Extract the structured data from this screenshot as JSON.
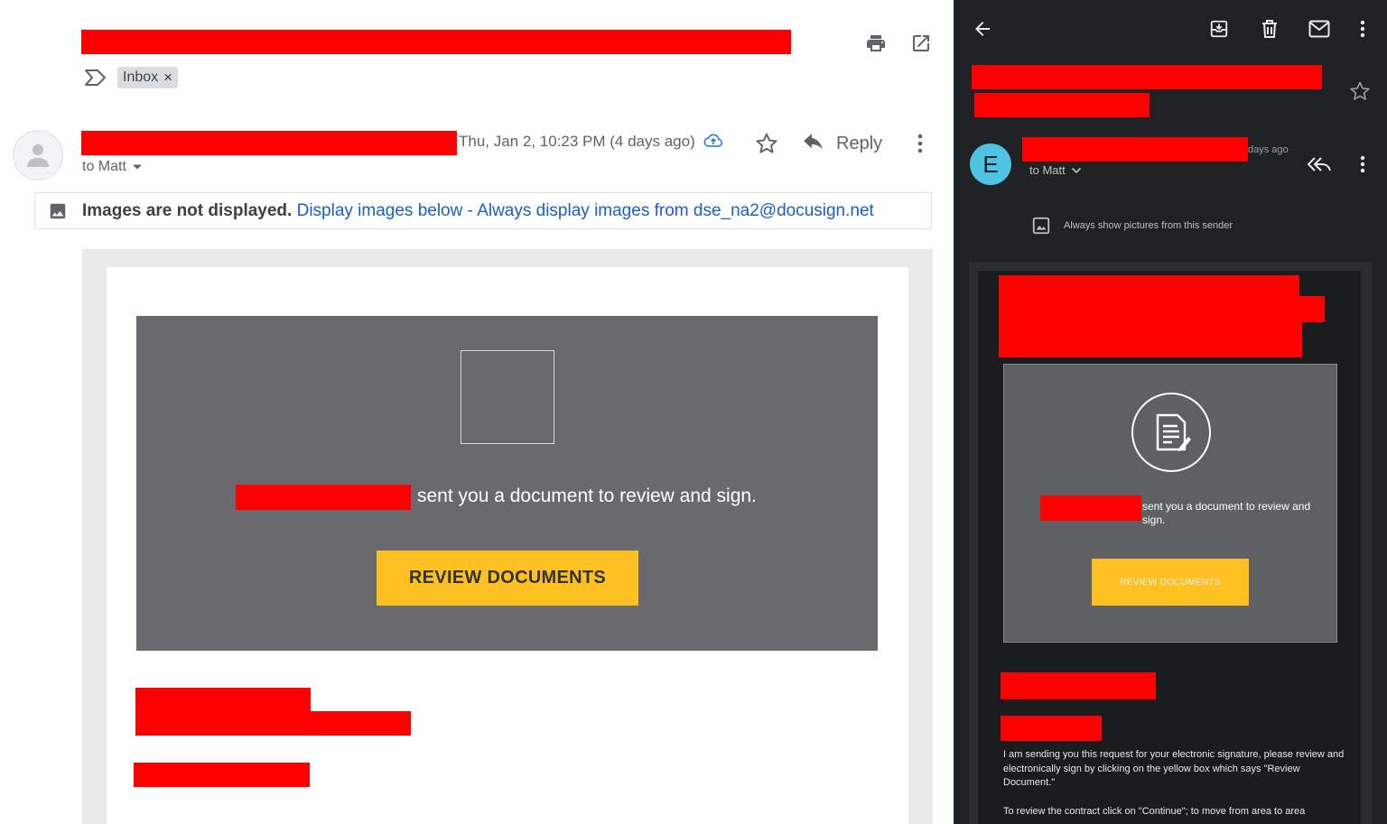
{
  "desktop": {
    "label_chip": {
      "label": "Inbox",
      "remove_glyph": "×"
    },
    "message": {
      "date": "Thu, Jan 2, 10:23 PM (4 days ago)",
      "recipient": "to Matt",
      "reply_label": "Reply"
    },
    "images_bar": {
      "bold_text": "Images are not displayed.",
      "display_below": "Display images below",
      "separator": "-",
      "always_display": "Always display images from dse_na2@docusign.net"
    },
    "email": {
      "sent_text": "sent you a document to review and sign.",
      "button_label": "REVIEW DOCUMENTS"
    },
    "icons": [
      "print-icon",
      "open-in-new-icon",
      "label-important-icon",
      "avatar-person-icon",
      "cloud-upload-icon",
      "star-icon",
      "reply-icon",
      "more-vert-icon",
      "image-icon"
    ]
  },
  "mobile": {
    "avatar_letter": "E",
    "time": "days ago",
    "recipient": "to Matt",
    "always_show": "Always show pictures from this sender",
    "email": {
      "sent_text": "sent you a document to review and sign.",
      "button_label": "REVIEW DOCUMENTS",
      "body_p1": "I am sending you this request for your electronic signature, please review and electronically sign by clicking on the yellow box which says \"Review Document.\"",
      "body_p2": "To review the contract click on \"Continue\"; to move from area to area"
    },
    "icons": [
      "back-arrow-icon",
      "archive-icon",
      "delete-icon",
      "mail-icon",
      "more-vert-icon",
      "star-icon",
      "reply-all-icon",
      "image-icon",
      "document-sign-icon"
    ]
  },
  "colors": {
    "redaction": "#ff0000",
    "link_blue": "#1a5fc6",
    "button_yellow": "#fdc020",
    "email_gray": "#6a6a6e",
    "dark_bg": "#202124"
  }
}
